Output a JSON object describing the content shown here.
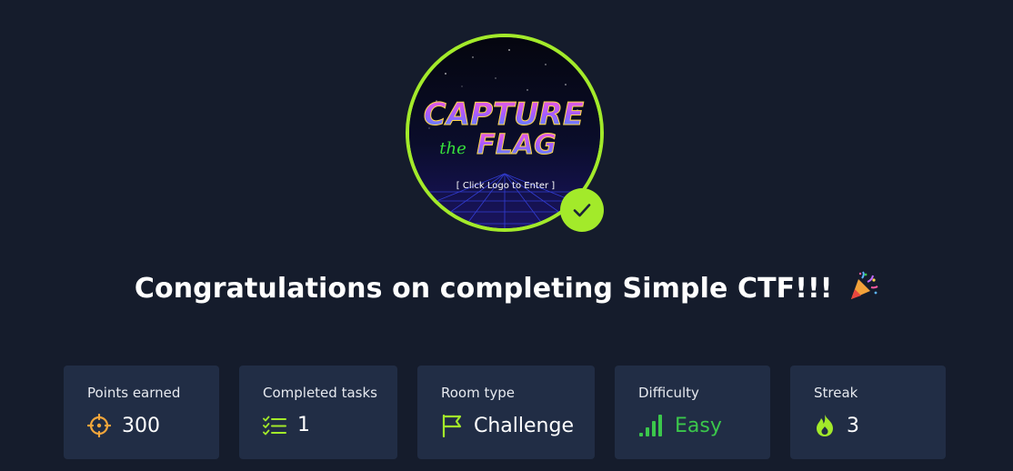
{
  "room": {
    "logo_alt": "Simple CTF room logo",
    "logo_line1": "CAPTURE",
    "logo_word_the": "the",
    "logo_line2": "FLAG",
    "logo_caption": "[ Click Logo to Enter ]",
    "completed": true
  },
  "heading": {
    "text": "Congratulations on completing Simple CTF!!!",
    "emoji_icon": "party-popper-icon"
  },
  "stats": [
    {
      "label": "Points earned",
      "value": "300",
      "icon": "target-icon",
      "icon_color": "#f3a63b"
    },
    {
      "label": "Completed tasks",
      "value": "1",
      "icon": "checklist-icon",
      "icon_color": "#a3ea2a"
    },
    {
      "label": "Room type",
      "value": "Challenge",
      "icon": "flag-icon",
      "icon_color": "#a3ea2a"
    },
    {
      "label": "Difficulty",
      "value": "Easy",
      "icon": "signal-bars-icon",
      "icon_color": "#3bc74b"
    },
    {
      "label": "Streak",
      "value": "3",
      "icon": "flame-icon",
      "icon_color": "#a3ea2a"
    }
  ],
  "colors": {
    "background": "#151c2c",
    "card": "#212d45",
    "accent": "#a3ea2a",
    "easy": "#3bc74b"
  }
}
